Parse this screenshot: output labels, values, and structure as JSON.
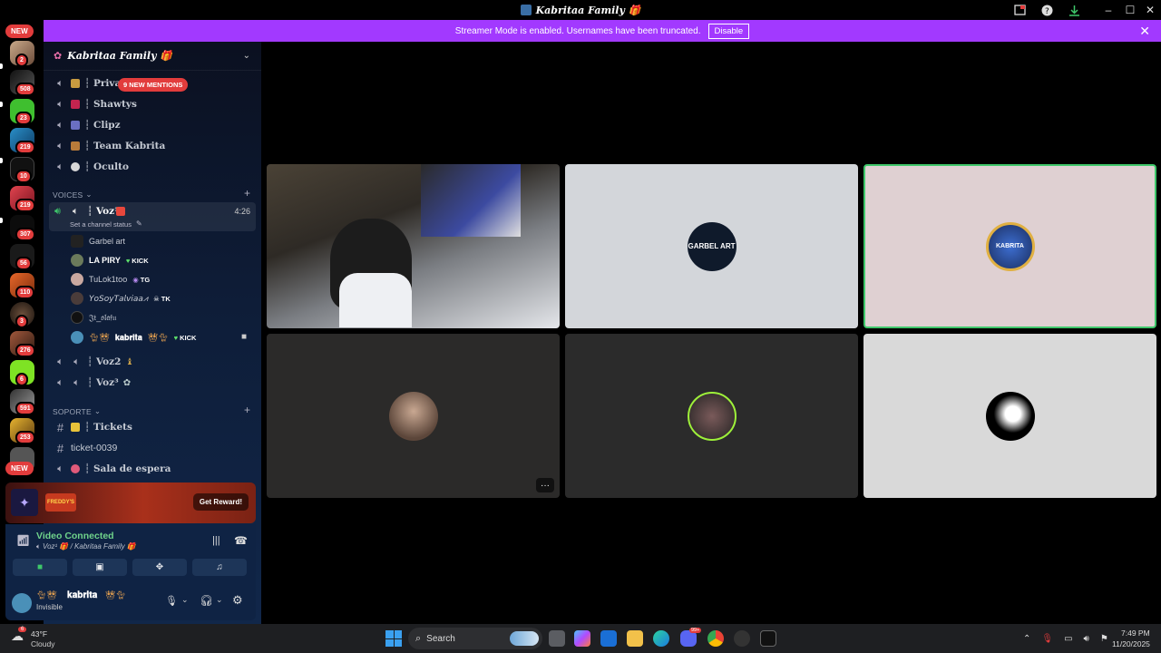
{
  "window": {
    "title": "Kabritaa Family 🎁"
  },
  "banner": {
    "text": "Streamer Mode is enabled. Usernames have been truncated.",
    "button": "Disable"
  },
  "guild_rail": {
    "new_top": "NEW",
    "new_bottom": "NEW",
    "badges": [
      "2",
      "508",
      "23",
      "219",
      "10",
      "219",
      "307",
      "56",
      "110",
      "3",
      "276",
      "6",
      "591",
      "253"
    ]
  },
  "server": {
    "name": "Kabritaa Family 🎁"
  },
  "mentions": "9 NEW MENTIONS",
  "channels_top": [
    {
      "name": "┆ Priva",
      "color": "#c89b40"
    },
    {
      "name": "┆ Shawtys",
      "color": "#c4244f"
    },
    {
      "name": "┆ Clipz",
      "color": "#6a6fc2"
    },
    {
      "name": "┆ Team Kabrita",
      "color": "#b87b3a"
    },
    {
      "name": "┆ Oculto",
      "color": "#d8d8d8"
    }
  ],
  "voices_category": {
    "label": "VOICES"
  },
  "active_voice": {
    "name": "┆ Voz¹",
    "time": "4:26",
    "status": "Set a channel status"
  },
  "members": [
    {
      "name": "Garbel art",
      "tag": ""
    },
    {
      "name": "LA PIRY",
      "tag": "KICK"
    },
    {
      "name": "TuLok1too",
      "tag": "TG"
    },
    {
      "name": "𝘠𝘰𝘚𝘰𝘺𝘛𝘢𝘭𝘷𝘪𝘢𝘢⩘",
      "tag": "TK"
    },
    {
      "name": "𝔍𝔱_𝔬𝔩𝔞𝔣𝔲",
      "tag": ""
    },
    {
      "name": "𝐤𝐚𝐛𝐫𝐢𝐭𝐚",
      "tag": "KICK"
    }
  ],
  "voices_more": [
    {
      "name": "┆ Voz2"
    },
    {
      "name": "┆ Voz³"
    }
  ],
  "soporte_category": {
    "label": "SOPORTE"
  },
  "soporte_channels": [
    {
      "name": "┆ Tickets"
    },
    {
      "name": "ticket-0039"
    },
    {
      "name": "┆ Sala de espera"
    }
  ],
  "promo": {
    "label": "FREDDY'S",
    "button": "Get Reward!"
  },
  "voice_panel": {
    "status": "Video Connected",
    "channel": "Voz¹ 🎁 / Kabritaa Family 🎁"
  },
  "user": {
    "name": "𝐤𝐚𝐛𝐫𝐢𝐭𝐚",
    "status": "Invisible"
  },
  "video_grid": {
    "tiles": [
      {
        "kind": "camera"
      },
      {
        "kind": "avatar",
        "bg": "#d3d6da",
        "avatar_text": "GARBEL ART"
      },
      {
        "kind": "avatar",
        "bg": "#dfd0d2",
        "avatar_text": "KABRITA"
      },
      {
        "kind": "avatar",
        "bg": "#2b2a29",
        "avatar_text": ""
      },
      {
        "kind": "avatar",
        "bg": "#2b2b2b",
        "avatar_text": ""
      },
      {
        "kind": "avatar",
        "bg": "#d9d9d9",
        "avatar_text": ""
      }
    ],
    "more_button": "···"
  },
  "taskbar": {
    "weather_temp": "43°F",
    "weather_desc": "Cloudy",
    "weather_badge": "6",
    "search": "Search",
    "discord_badge": "99+",
    "time": "7:49 PM",
    "date": "11/20/2025"
  },
  "colors": {
    "accent": "#a239ff",
    "danger": "#e23c3c",
    "voice_green": "#6fd38b"
  }
}
